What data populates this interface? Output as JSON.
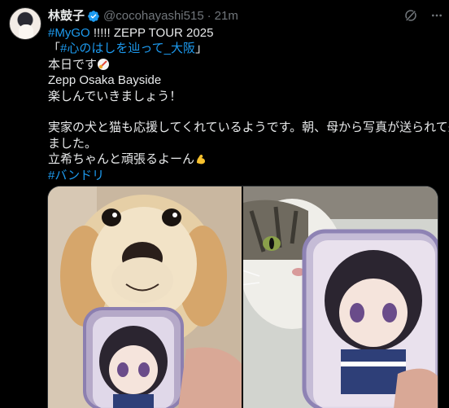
{
  "author": {
    "display_name": "林鼓子",
    "handle": "@cocohayashi515",
    "separator": "·",
    "time": "21m"
  },
  "tweet": {
    "line1_hashtag": "#MyGO",
    "line1_text": " !!!!! ZEPP TOUR 2025",
    "line2_open": "「",
    "line2_hashtag": "#心のはしを辿って_大阪",
    "line2_close": "」",
    "line3_text": "本日です",
    "line4_text": "Zepp Osaka Bayside",
    "line5_text": "楽しんでいきましょう！",
    "line6_text": "実家の犬と猫も応援してくれているようです。朝、母から写真が送られて来",
    "line7_text": "ました。",
    "line8_text": "立希ちゃんと頑張るよーん",
    "line9_hashtag": "#バンドリ"
  },
  "media": {
    "photo1": "dog-with-plush-keychain",
    "photo2": "cat-with-plush-keychain"
  },
  "icons": {
    "verified": "verified-badge-icon",
    "grok": "grok-icon",
    "more": "more-options-icon",
    "emoji1": "guitar-emoji-icon",
    "emoji2": "flexed-biceps-emoji-icon"
  },
  "colors": {
    "background": "#000000",
    "text": "#e7e9ea",
    "secondary": "#71767b",
    "link": "#1d9bf0"
  }
}
